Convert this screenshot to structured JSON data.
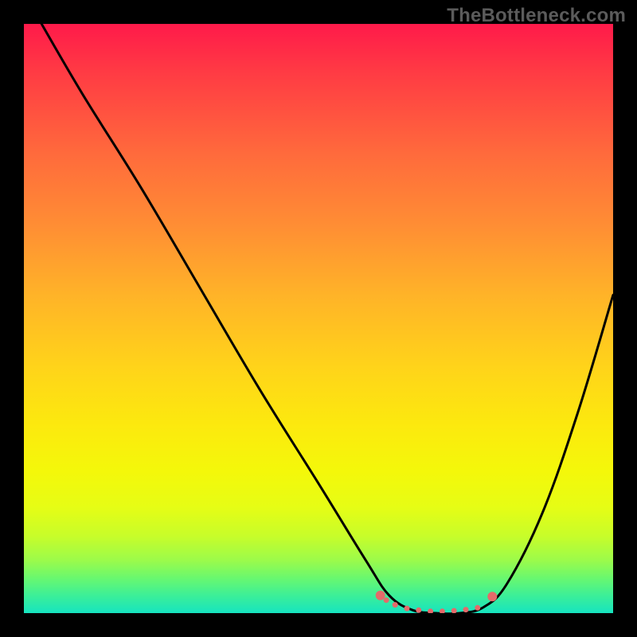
{
  "watermark": "TheBottleneck.com",
  "chart_data": {
    "type": "line",
    "title": "",
    "xlabel": "",
    "ylabel": "",
    "xlim": [
      0,
      100
    ],
    "ylim": [
      0,
      100
    ],
    "gradient_stops": [
      {
        "pos": 0,
        "color": "#ff1a4a"
      },
      {
        "pos": 8,
        "color": "#ff3a44"
      },
      {
        "pos": 22,
        "color": "#ff6a3c"
      },
      {
        "pos": 34,
        "color": "#ff8d34"
      },
      {
        "pos": 46,
        "color": "#ffb328"
      },
      {
        "pos": 58,
        "color": "#ffd31a"
      },
      {
        "pos": 68,
        "color": "#fce90e"
      },
      {
        "pos": 76,
        "color": "#f4f80a"
      },
      {
        "pos": 82,
        "color": "#e6fd15"
      },
      {
        "pos": 87,
        "color": "#c7fd2a"
      },
      {
        "pos": 91,
        "color": "#9cfb4a"
      },
      {
        "pos": 94,
        "color": "#6af86e"
      },
      {
        "pos": 97,
        "color": "#3cef98"
      },
      {
        "pos": 100,
        "color": "#16e4c0"
      }
    ],
    "series": [
      {
        "name": "bottleneck-curve",
        "x": [
          3,
          10,
          20,
          30,
          40,
          50,
          58,
          62,
          66,
          70,
          74,
          78,
          82,
          88,
          94,
          100
        ],
        "y": [
          100,
          88,
          72,
          55,
          38,
          22,
          9,
          3,
          0.5,
          0,
          0,
          1,
          5,
          17,
          34,
          54
        ]
      }
    ],
    "markers": {
      "name": "flat-valley-dots",
      "color": "#e46a6a",
      "points": [
        {
          "x": 60.5,
          "y": 3.0
        },
        {
          "x": 61.5,
          "y": 2.2
        },
        {
          "x": 63.0,
          "y": 1.4
        },
        {
          "x": 65.0,
          "y": 0.8
        },
        {
          "x": 67.0,
          "y": 0.5
        },
        {
          "x": 69.0,
          "y": 0.3
        },
        {
          "x": 71.0,
          "y": 0.3
        },
        {
          "x": 73.0,
          "y": 0.4
        },
        {
          "x": 75.0,
          "y": 0.6
        },
        {
          "x": 77.0,
          "y": 0.9
        },
        {
          "x": 79.5,
          "y": 2.8
        }
      ]
    }
  }
}
